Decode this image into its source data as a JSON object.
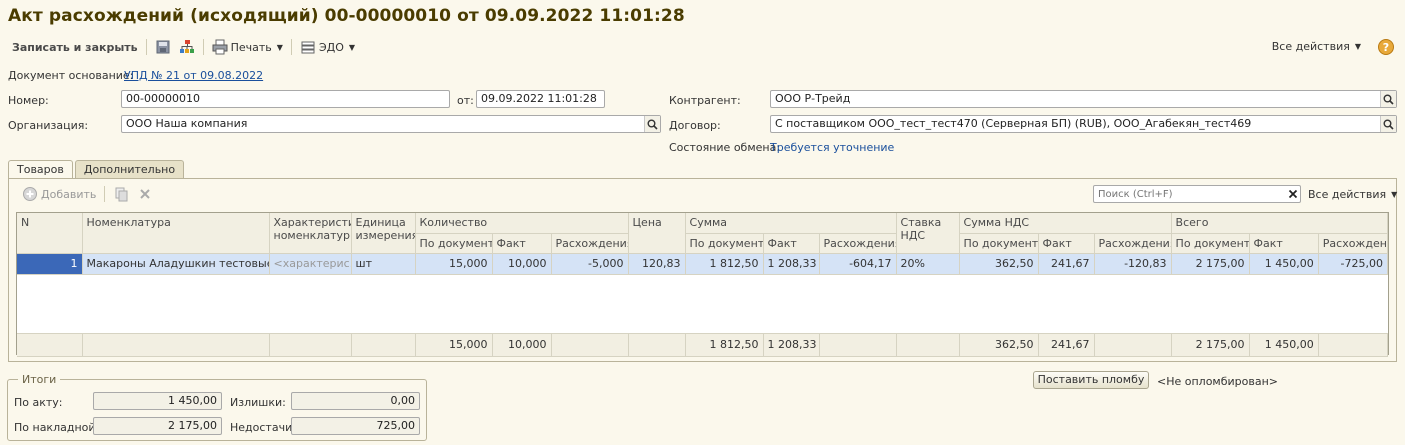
{
  "title": "Акт расхождений (исходящий) 00-00000010 от 09.09.2022 11:01:28",
  "toolbar": {
    "save_close": "Записать и закрыть",
    "print": "Печать",
    "edo": "ЭДО",
    "all_actions": "Все действия",
    "help": "?"
  },
  "header": {
    "base_doc_label": "Документ основание:",
    "base_doc_link": "УПД № 21 от 09.08.2022",
    "number_label": "Номер:",
    "number_value": "00-00000010",
    "from_label": "от:",
    "from_value": "09.09.2022 11:01:28",
    "org_label": "Организация:",
    "org_value": "ООО Наша компания",
    "counterparty_label": "Контрагент:",
    "counterparty_value": "ООО Р-Трейд",
    "contract_label": "Договор:",
    "contract_value": "С поставщиком ООО_тест_тест470 (Серверная БП) (RUB), ООО_Агабекян_тест469",
    "exchange_label": "Состояние обмена:",
    "exchange_value": "Требуется уточнение"
  },
  "tabs": [
    "Товаров",
    "Дополнительно"
  ],
  "table_toolbar": {
    "add": "Добавить",
    "search_placeholder": "Поиск (Ctrl+F)",
    "all_actions": "Все действия"
  },
  "table": {
    "headers": {
      "n": "N",
      "nomenclature": "Номенклатура",
      "characteristic": "Характеристи номенклатуры",
      "unit": "Единица измерения",
      "quantity": "Количество",
      "price": "Цена",
      "sum": "Сумма",
      "vat_rate": "Ставка НДС",
      "vat_sum": "Сумма НДС",
      "total": "Всего",
      "by_doc": "По документу",
      "fact": "Факт",
      "diff": "Расхождения"
    },
    "rows": [
      {
        "n": "1",
        "nomenclature": "Макароны Аладушкин  тестовые",
        "characteristic": "<характерис...",
        "unit": "шт",
        "qty_doc": "15,000",
        "qty_fact": "10,000",
        "qty_diff": "-5,000",
        "price": "120,83",
        "sum_doc": "1 812,50",
        "sum_fact": "1 208,33",
        "sum_diff": "-604,17",
        "vat_rate": "20%",
        "vat_doc": "362,50",
        "vat_fact": "241,67",
        "vat_diff": "-120,83",
        "total_doc": "2 175,00",
        "total_fact": "1 450,00",
        "total_diff": "-725,00"
      }
    ],
    "footer": {
      "qty_doc": "15,000",
      "qty_fact": "10,000",
      "sum_doc": "1 812,50",
      "sum_fact": "1 208,33",
      "vat_doc": "362,50",
      "vat_fact": "241,67",
      "total_doc": "2 175,00",
      "total_fact": "1 450,00"
    }
  },
  "totals": {
    "legend": "Итоги",
    "by_act_label": "По акту:",
    "by_act_value": "1 450,00",
    "by_invoice_label": "По накладной:",
    "by_invoice_value": "2 175,00",
    "surplus_label": "Излишки:",
    "surplus_value": "0,00",
    "shortage_label": "Недостачи:",
    "shortage_value": "725,00"
  },
  "seal": {
    "button": "Поставить пломбу",
    "status": "<Не опломбирован>"
  }
}
